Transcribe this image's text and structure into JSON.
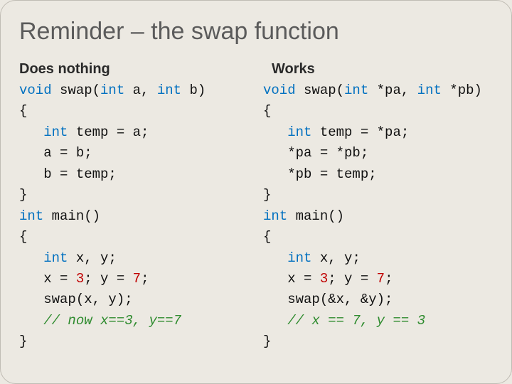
{
  "title": "Reminder – the swap function",
  "left": {
    "heading": "Does nothing",
    "sig_pre": " swap(",
    "sig_params": " a, ",
    "sig_params2": " b)",
    "l_brace": "{",
    "temp_pre": " temp = a;",
    "l_a": "   a = b;",
    "l_b": "   b = temp;",
    "r_brace": "}",
    "main_pre": " main()",
    "m_brace": "{",
    "decl_pre": " x, y;",
    "assign_pre": "   x = ",
    "assign_mid": "; y = ",
    "assign_end": ";",
    "call": "   swap(x, y);",
    "comment": "// now x==3, y==7",
    "end_brace": "}",
    "kw_void": "void",
    "kw_int": "int",
    "num_3": "3",
    "num_7": "7"
  },
  "right": {
    "heading": "Works",
    "sig_pre": " swap(",
    "sig_params": " *pa, ",
    "sig_params2": " *pb)",
    "l_brace": "{",
    "temp_pre": " temp = *pa;",
    "l_a": "   *pa = *pb;",
    "l_b": "   *pb = temp;",
    "r_brace": "}",
    "main_pre": " main()",
    "m_brace": "{",
    "decl_pre": " x, y;",
    "assign_pre": "   x = ",
    "assign_mid": "; y = ",
    "assign_end": ";",
    "call": "   swap(&x, &y);",
    "comment": "// x == 7, y == 3",
    "end_brace": "}",
    "kw_void": "void",
    "kw_int": "int",
    "num_3": "3",
    "num_7": "7"
  }
}
